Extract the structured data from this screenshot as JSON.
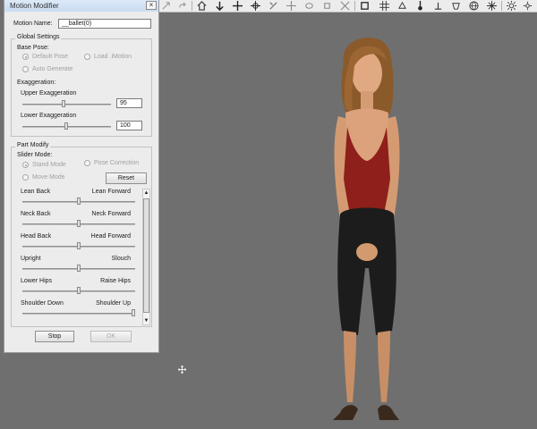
{
  "dialog": {
    "title": "Motion Modifier",
    "close_glyph": "×",
    "motion_name_label": "Motion Name:",
    "motion_name_value": "__ballet(0)",
    "global_settings": {
      "title": "Global Settings",
      "base_pose_label": "Base Pose:",
      "base_pose_options": [
        "Default Pose",
        "Load .iMotion",
        "Auto Generate"
      ],
      "base_pose_selected": "Default Pose",
      "exaggeration_label": "Exaggeration:",
      "upper_label": "Upper Exaggeration",
      "upper_value": "95",
      "lower_label": "Lower Exaggeration",
      "lower_value": "100"
    },
    "part_modify": {
      "title": "Part Modify",
      "slider_mode_label": "Slider Mode:",
      "slider_mode_options": [
        "Stand Mode",
        "Pose Correction",
        "Move Mode"
      ],
      "slider_mode_selected": "Stand Mode",
      "reset_label": "Reset",
      "sliders": [
        {
          "left": "Lean Back",
          "right": "Lean Forward",
          "level": 0.5
        },
        {
          "left": "Neck Back",
          "right": "Neck Forward",
          "level": 0.5
        },
        {
          "left": "Head Back",
          "right": "Head Forward",
          "level": 0.5
        },
        {
          "left": "Upright",
          "right": "Slouch",
          "level": 0.5
        },
        {
          "left": "Lower Hips",
          "right": "Raise Hips",
          "level": 0.5
        },
        {
          "left": "Shoulder Down",
          "right": "Shoulder Up",
          "level": 1.0
        }
      ]
    },
    "stop_label": "Stop",
    "ok_label": "OK"
  },
  "toolbar": {
    "icons": [
      "arrow-icon",
      "redo-icon",
      "home-icon",
      "move-down-icon",
      "move-cross-icon",
      "rotate-pivot-icon",
      "zoom-icon",
      "pan-icon",
      "orbit-icon",
      "rotate-icon",
      "fit-icon",
      "frame-icon",
      "grid-icon",
      "paint-icon",
      "light-probe-icon",
      "light-point-icon",
      "light-spot-icon",
      "sphere-icon",
      "settings-icon",
      "sun-icon",
      "sun-small-icon",
      "sun-tiny-icon"
    ]
  },
  "colors": {
    "viewport": "#6f6f6f",
    "panel": "#ececec",
    "titlebar": "#c9dcf1",
    "dress": "#8e1f1a",
    "pants": "#1b1b1b",
    "skin": "#d9a07a",
    "hair": "#8b5a2b"
  }
}
